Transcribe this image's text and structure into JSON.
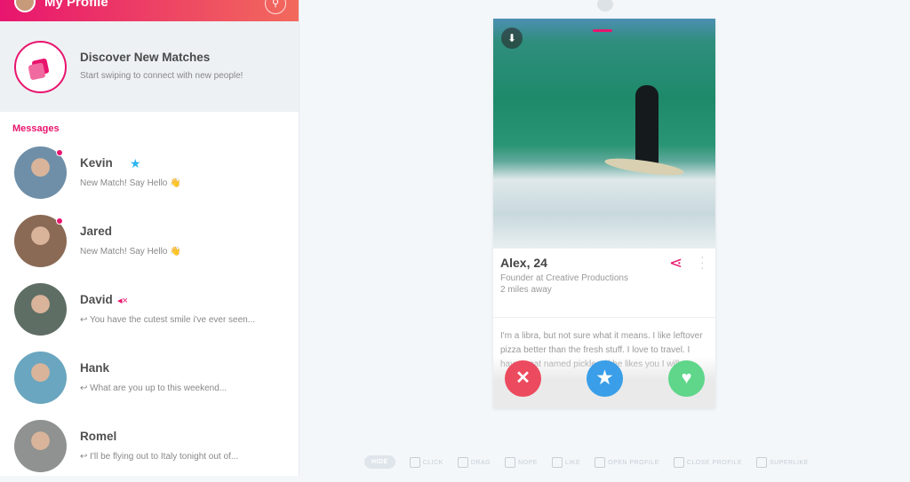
{
  "header": {
    "title": "My Profile",
    "search_icon": "search-icon"
  },
  "discover": {
    "title": "Discover New Matches",
    "subtitle": "Start swiping to connect with new people!"
  },
  "messages": {
    "label": "Messages",
    "items": [
      {
        "name": "Kevin",
        "preview": "New Match! Say Hello 👋",
        "unread": true,
        "badge": "★",
        "avatar_color": "#6f8fa8"
      },
      {
        "name": "Jared",
        "preview": "New Match! Say Hello 👋",
        "unread": true,
        "avatar_color": "#8a6a55"
      },
      {
        "name": "David",
        "preview": "↩ You have the cutest smile i've ever seen...",
        "muted": true,
        "avatar_color": "#5f6e64"
      },
      {
        "name": "Hank",
        "preview": "↩ What are you up to this weekend...",
        "avatar_color": "#6aa6bf"
      },
      {
        "name": "Romel",
        "preview": "↩ I'll be flying out to Italy tonight out of...",
        "avatar_color": "#8f9290"
      }
    ]
  },
  "profile": {
    "name_age": "Alex, 24",
    "job": "Founder at Creative Productions",
    "distance": "2 miles away",
    "bio": "I'm a libra, but not sure what it means. I like leftover pizza better than the fresh stuff. I love to travel. I have a cat named pickles, if he likes you I will too."
  },
  "actions": {
    "nope": "✕",
    "superlike": "★",
    "like": "♥",
    "colors": {
      "nope": "#ec4a5e",
      "superlike": "#3a9ee8",
      "like": "#5fd68a"
    }
  },
  "hints": {
    "hide": "HIDE",
    "items": [
      "CLICK",
      "DRAG",
      "NOPE",
      "LIKE",
      "OPEN PROFILE",
      "CLOSE PROFILE",
      "SUPERLIKE"
    ]
  }
}
